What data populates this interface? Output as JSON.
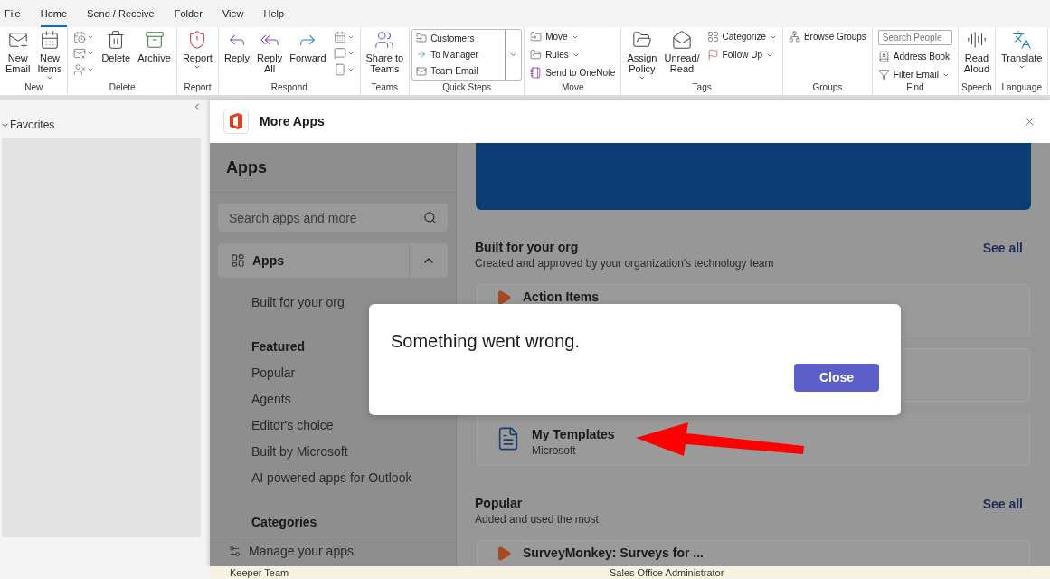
{
  "menu": [
    {
      "label": "File",
      "selected": false
    },
    {
      "label": "Home",
      "selected": true
    },
    {
      "label": "Send / Receive",
      "selected": false
    },
    {
      "label": "Folder",
      "selected": false
    },
    {
      "label": "View",
      "selected": false
    },
    {
      "label": "Help",
      "selected": false
    }
  ],
  "ribbon": [
    {
      "label": "New",
      "items": [
        {
          "kind": "large",
          "label": "New\nEmail",
          "dropdown": false
        },
        {
          "kind": "large",
          "label": "New\nItems",
          "dropdown": true
        }
      ]
    },
    {
      "label": "Delete",
      "items": [
        {
          "kind": "icons"
        },
        {
          "kind": "large",
          "label": "Delete",
          "dropdown": false
        },
        {
          "kind": "large",
          "label": "Archive",
          "dropdown": false
        }
      ]
    },
    {
      "label": "Report",
      "items": [
        {
          "kind": "large",
          "label": "Report",
          "dropdown": true
        }
      ]
    },
    {
      "label": "Respond",
      "items": [
        {
          "kind": "large",
          "label": "Reply",
          "dropdown": false
        },
        {
          "kind": "large",
          "label": "Reply\nAll",
          "dropdown": false
        },
        {
          "kind": "large",
          "label": "Forward",
          "dropdown": false
        },
        {
          "kind": "icons"
        }
      ]
    },
    {
      "label": "Teams",
      "items": [
        {
          "kind": "large",
          "label": "Share to\nTeams",
          "dropdown": false
        }
      ]
    },
    {
      "label": "Quick Steps",
      "items": [
        {
          "kind": "gallery",
          "entries": [
            "Customers",
            "To Manager",
            "Team Email"
          ]
        }
      ]
    },
    {
      "label": "Move",
      "items": [
        {
          "kind": "small",
          "entries": [
            {
              "label": "Move",
              "dropdown": true
            },
            {
              "label": "Rules",
              "dropdown": true
            },
            {
              "label": "Send to OneNote",
              "dropdown": false
            }
          ]
        }
      ]
    },
    {
      "label": "Tags",
      "items": [
        {
          "kind": "large",
          "label": "Assign\nPolicy",
          "dropdown": true
        },
        {
          "kind": "large",
          "label": "Unread/\nRead",
          "dropdown": false
        },
        {
          "kind": "small",
          "entries": [
            {
              "label": "Categorize",
              "dropdown": true
            },
            {
              "label": "Follow Up",
              "dropdown": true
            }
          ]
        }
      ]
    },
    {
      "label": "Groups",
      "items": [
        {
          "kind": "small",
          "entries": [
            {
              "label": "Browse Groups",
              "dropdown": false
            }
          ]
        }
      ]
    },
    {
      "label": "Find",
      "items": [
        {
          "kind": "find",
          "placeholder": "Search People",
          "entries": [
            {
              "label": "Address Book",
              "dropdown": false
            },
            {
              "label": "Filter Email",
              "dropdown": true
            }
          ]
        }
      ]
    },
    {
      "label": "Speech",
      "items": [
        {
          "kind": "large",
          "label": "Read\nAloud",
          "dropdown": false
        }
      ]
    },
    {
      "label": "Language",
      "items": [
        {
          "kind": "large",
          "label": "Translate",
          "dropdown": true
        }
      ]
    }
  ],
  "folder_pane": {
    "section": "Favorites"
  },
  "more_apps": {
    "title": "More Apps",
    "nav": {
      "title": "Apps",
      "search_placeholder": "Search apps and more",
      "section": "Apps",
      "expanded": true,
      "items": [
        {
          "kind": "link",
          "label": "Built for your org"
        },
        {
          "kind": "heading",
          "label": "Featured"
        },
        {
          "kind": "link",
          "label": "Popular"
        },
        {
          "kind": "link",
          "label": "Agents"
        },
        {
          "kind": "link",
          "label": "Editor's choice"
        },
        {
          "kind": "link",
          "label": "Built by Microsoft"
        },
        {
          "kind": "link",
          "label": "AI powered apps for Outlook"
        },
        {
          "kind": "heading",
          "label": "Categories"
        }
      ],
      "footer": "Manage your apps"
    },
    "sections": [
      {
        "title": "Built for your org",
        "subtitle": "Created and approved by your organization's technology team",
        "see_all": "See all",
        "cards": [
          {
            "kind": "partial",
            "title": "Action Items"
          },
          {
            "kind": "covered"
          },
          {
            "kind": "app",
            "title": "My Templates",
            "publisher": "Microsoft"
          }
        ]
      },
      {
        "title": "Popular",
        "subtitle": "Added and used the most",
        "see_all": "See all",
        "cards": [
          {
            "kind": "partial",
            "title": "SurveyMonkey: Surveys for ..."
          }
        ]
      }
    ]
  },
  "background_list": [
    "Keeper Team",
    "Sales Office Administrator"
  ],
  "error_dialog": {
    "message": "Something went wrong.",
    "button": "Close"
  }
}
